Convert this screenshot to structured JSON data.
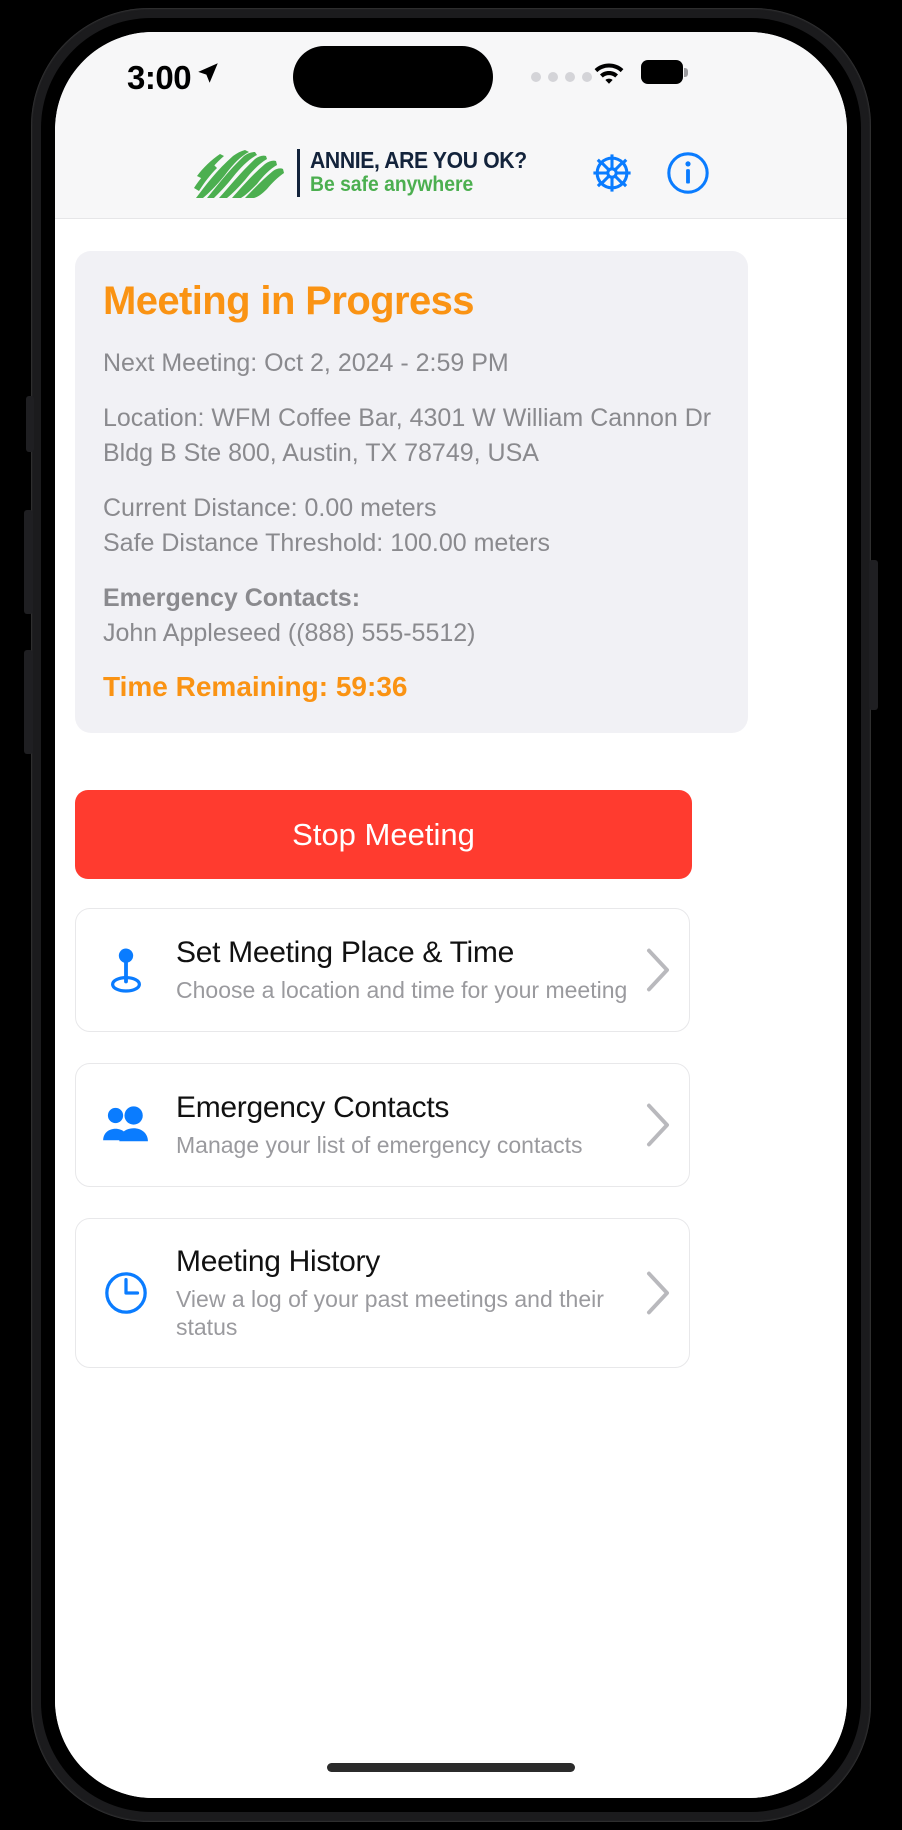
{
  "status_bar": {
    "time": "3:00",
    "location_arrow_icon": "location-arrow-icon",
    "signal_icon": "cellular-dots-icon",
    "wifi_icon": "wifi-icon",
    "battery_icon": "battery-full-icon"
  },
  "header": {
    "logo_icon": "zebra-stripes-logo",
    "title": "ANNIE, ARE YOU OK?",
    "tagline": "Be safe anywhere",
    "settings_icon": "gear-icon",
    "info_icon": "info-circle-icon",
    "accent_blue": "#0a7cff",
    "title_color": "#13233b",
    "tagline_color": "#4caf50"
  },
  "status_card": {
    "heading": "Meeting in Progress",
    "next_meeting": "Next Meeting: Oct 2, 2024 - 2:59 PM",
    "location": "Location: WFM Coffee Bar, 4301 W William Cannon Dr Bldg B Ste 800, Austin, TX 78749, USA",
    "current_distance": "Current Distance: 0.00 meters",
    "safe_distance": "Safe Distance Threshold: 100.00 meters",
    "contacts_label": "Emergency Contacts:",
    "contact_entry": "John Appleseed ((888) 555-5512)",
    "time_remaining": "Time Remaining: 59:36",
    "accent_color": "#fa9313",
    "background": "#f1f1f5"
  },
  "stop_button": {
    "label": "Stop Meeting",
    "color": "#ff3b2f"
  },
  "menu": {
    "items": [
      {
        "icon": "map-pin-icon",
        "title": "Set Meeting Place & Time",
        "subtitle": "Choose a location and time for your meeting",
        "chevron": "chevron-right-icon"
      },
      {
        "icon": "people-group-icon",
        "title": "Emergency Contacts",
        "subtitle": "Manage your list of emergency contacts",
        "chevron": "chevron-right-icon"
      },
      {
        "icon": "clock-icon",
        "title": "Meeting History",
        "subtitle": "View a log of your past meetings and their status",
        "chevron": "chevron-right-icon"
      }
    ],
    "icon_color": "#0a7cff"
  }
}
